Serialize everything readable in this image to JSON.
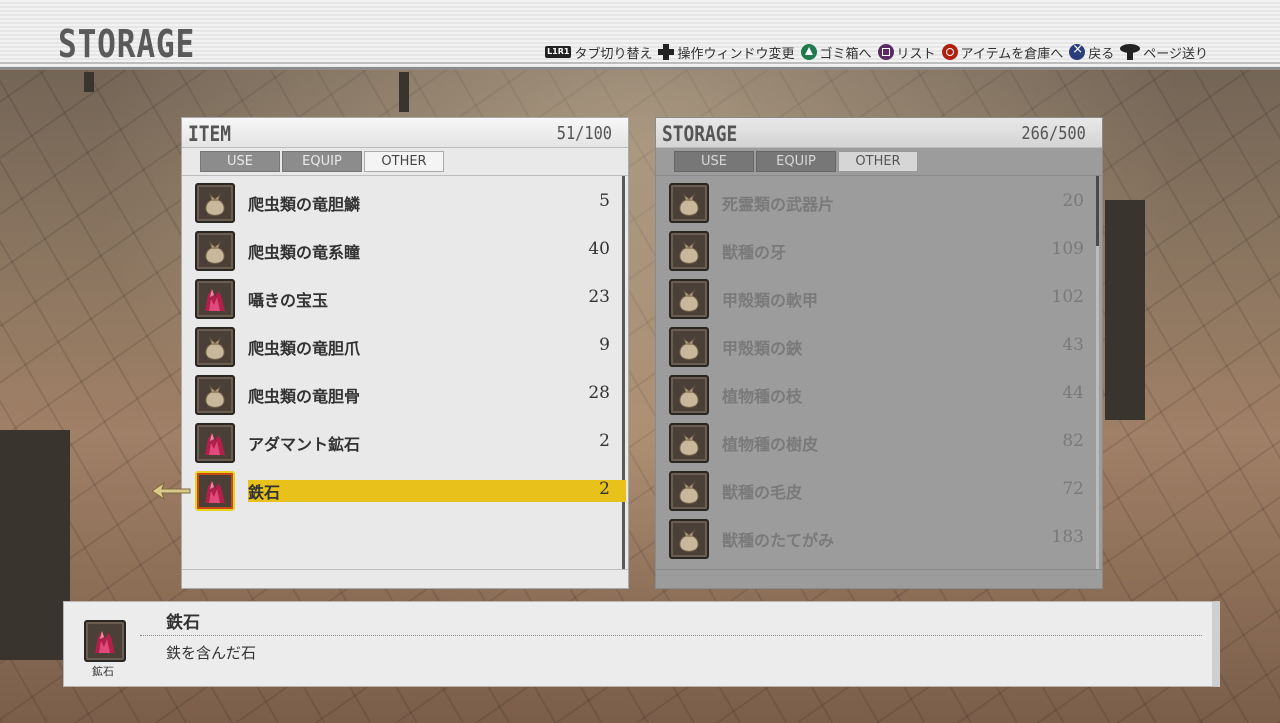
{
  "header": {
    "title": "STORAGE",
    "controls": [
      {
        "icon": "l1-r1-icon",
        "keys": "L1R1",
        "label": "タブ切り替え"
      },
      {
        "icon": "dpad-icon",
        "label": "操作ウィンドウ変更"
      },
      {
        "icon": "triangle-button-icon",
        "label": "ゴミ箱へ"
      },
      {
        "icon": "square-button-icon",
        "label": "リスト"
      },
      {
        "icon": "circle-button-icon",
        "label": "アイテムを倉庫へ"
      },
      {
        "icon": "cross-button-icon",
        "label": "戻る"
      },
      {
        "icon": "right-stick-icon",
        "label": "ページ送り"
      }
    ]
  },
  "item_panel": {
    "title": "ITEM",
    "count": "51/100",
    "tabs": [
      "USE",
      "EQUIP",
      "OTHER"
    ],
    "active_tab": "OTHER",
    "items": [
      {
        "icon": "pouch-icon",
        "name": "爬虫類の竜胆鱗",
        "qty": "5"
      },
      {
        "icon": "pouch-icon",
        "name": "爬虫類の竜系瞳",
        "qty": "40"
      },
      {
        "icon": "crystal-icon",
        "name": "囁きの宝玉",
        "qty": "23"
      },
      {
        "icon": "pouch-icon",
        "name": "爬虫類の竜胆爪",
        "qty": "9"
      },
      {
        "icon": "pouch-icon",
        "name": "爬虫類の竜胆骨",
        "qty": "28"
      },
      {
        "icon": "crystal-icon",
        "name": "アダマント鉱石",
        "qty": "2"
      },
      {
        "icon": "crystal-icon",
        "name": "鉄石",
        "qty": "2",
        "selected": true
      }
    ]
  },
  "storage_panel": {
    "title": "STORAGE",
    "count": "266/500",
    "tabs": [
      "USE",
      "EQUIP",
      "OTHER"
    ],
    "active_tab": "OTHER",
    "items": [
      {
        "icon": "pouch-icon",
        "name": "死霊類の武器片",
        "qty": "20"
      },
      {
        "icon": "pouch-icon",
        "name": "獣種の牙",
        "qty": "109"
      },
      {
        "icon": "pouch-icon",
        "name": "甲殻類の軟甲",
        "qty": "102"
      },
      {
        "icon": "pouch-icon",
        "name": "甲殻類の鋏",
        "qty": "43"
      },
      {
        "icon": "pouch-icon",
        "name": "植物種の枝",
        "qty": "44"
      },
      {
        "icon": "pouch-icon",
        "name": "植物種の樹皮",
        "qty": "82"
      },
      {
        "icon": "pouch-icon",
        "name": "獣種の毛皮",
        "qty": "72"
      },
      {
        "icon": "pouch-icon",
        "name": "獣種のたてがみ",
        "qty": "183"
      }
    ]
  },
  "description": {
    "icon": "crystal-icon",
    "category": "鉱石",
    "name": "鉄石",
    "text": "鉄を含んだ石"
  },
  "colors": {
    "selection": "#e8c21a",
    "header_bg": "#eeeeee",
    "panel_bg": "#e9e9e9",
    "storage_panel_bg": "#9c9c9c"
  }
}
